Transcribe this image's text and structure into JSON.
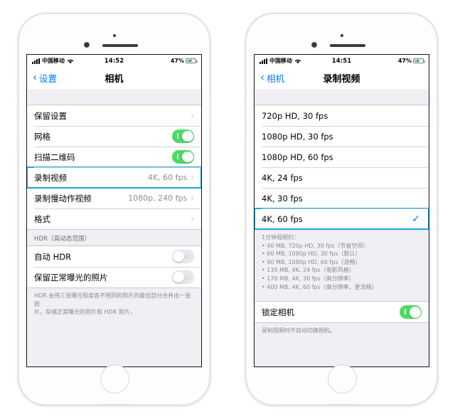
{
  "accent": {
    "ios_blue": "#007aff",
    "highlight_cyan": "#1ca3dd",
    "toggle_green": "#4cd964",
    "group_bg": "#efeff4"
  },
  "phones": [
    {
      "id": "left",
      "status_bar": {
        "carrier": "中国移动",
        "time": "14:52",
        "battery_pct": "47%",
        "signal_icon": "cellular-bars-icon",
        "wifi_icon": "wifi-icon",
        "battery_icon": "battery-charging-icon"
      },
      "nav": {
        "back_label": "设置",
        "back_icon": "chevron-left-icon",
        "title": "相机"
      },
      "groups": [
        {
          "rows": [
            {
              "label": "保留设置",
              "type": "disclosure",
              "value": ""
            },
            {
              "label": "网格",
              "type": "toggle",
              "on": true
            },
            {
              "label": "扫描二维码",
              "type": "toggle",
              "on": true
            },
            {
              "label": "录制视频",
              "type": "disclosure",
              "value": "4K, 60 fps",
              "highlight": true
            },
            {
              "label": "录制慢动作视频",
              "type": "disclosure",
              "value": "1080p, 240 fps"
            },
            {
              "label": "格式",
              "type": "disclosure",
              "value": ""
            }
          ]
        },
        {
          "header": "HDR（高动态范围）",
          "rows": [
            {
              "label": "自动 HDR",
              "type": "toggle",
              "on": false
            },
            {
              "label": "保留正常曝光的照片",
              "type": "toggle",
              "on": false
            }
          ],
          "footer_lines": [
            "HDR 会用三张曝光程度各不相同的照片的最佳部分合并出一张照",
            "片。存储正常曝光的照片和 HDR 照片。"
          ]
        }
      ]
    },
    {
      "id": "right",
      "status_bar": {
        "carrier": "中国移动",
        "time": "14:51",
        "battery_pct": "47%",
        "signal_icon": "cellular-bars-icon",
        "wifi_icon": "wifi-icon",
        "battery_icon": "battery-charging-icon"
      },
      "nav": {
        "back_label": "相机",
        "back_icon": "chevron-left-icon",
        "title": "录制视频"
      },
      "groups": [
        {
          "rows": [
            {
              "label": "720p HD, 30 fps",
              "type": "option",
              "selected": false
            },
            {
              "label": "1080p HD, 30 fps",
              "type": "option",
              "selected": false
            },
            {
              "label": "1080p HD, 60 fps",
              "type": "option",
              "selected": false
            },
            {
              "label": "4K, 24 fps",
              "type": "option",
              "selected": false
            },
            {
              "label": "4K, 30 fps",
              "type": "option",
              "selected": false
            },
            {
              "label": "4K, 60 fps",
              "type": "option",
              "selected": true,
              "highlight": true
            }
          ],
          "footer_lines": [
            "1分钟视频约：",
            "• 40 MB, 720p HD, 30 fps（节省空间）",
            "• 60 MB, 1080p HD, 30 fps（默认）",
            "• 90 MB, 1080p HD, 60 fps（流畅）",
            "• 135 MB, 4K, 24 fps（电影风格）",
            "• 170 MB, 4K, 30 fps（高分辨率）",
            "• 400 MB, 4K, 60 fps（高分辨率、更流畅）"
          ]
        },
        {
          "rows": [
            {
              "label": "锁定相机",
              "type": "toggle",
              "on": true
            }
          ],
          "footer_lines": [
            "录制视频时不自动切换相机。"
          ]
        }
      ]
    }
  ]
}
